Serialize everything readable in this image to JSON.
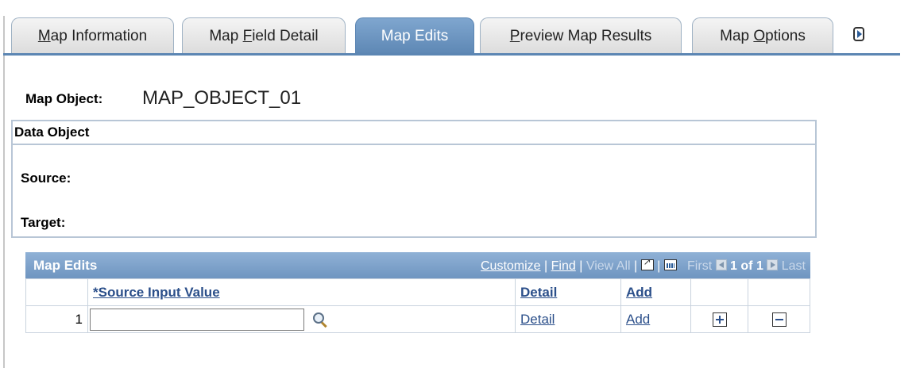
{
  "tabs": [
    {
      "pre": "",
      "u": "M",
      "post": "ap Information"
    },
    {
      "pre": "Map ",
      "u": "F",
      "post": "ield Detail"
    },
    {
      "pre": "Map Edits",
      "u": "",
      "post": ""
    },
    {
      "pre": "",
      "u": "P",
      "post": "review Map Results"
    },
    {
      "pre": "Map ",
      "u": "O",
      "post": "ptions"
    }
  ],
  "header": {
    "map_object_label": "Map Object:",
    "map_object_value": "MAP_OBJECT_01"
  },
  "data_object": {
    "title": "Data Object",
    "source_label": "Source:",
    "target_label": "Target:"
  },
  "grid": {
    "title": "Map Edits",
    "customize": "Customize",
    "sep": "|",
    "find": "Find",
    "view_all": "View All",
    "first": "First",
    "count": "1 of 1",
    "last": "Last",
    "columns": {
      "source_input_value": "*Source Input Value",
      "detail": "Detail",
      "add": "Add"
    },
    "rows": [
      {
        "num": "1",
        "source_input_value": "",
        "detail": "Detail",
        "add": "Add"
      }
    ]
  },
  "colors": {
    "accent": "#5c86b3",
    "grid_header": "#7fa3cb",
    "link": "#2b4f8a"
  },
  "icons": {
    "lookup": "search-icon",
    "add_row": "plus-icon",
    "delete_row": "minus-icon"
  }
}
